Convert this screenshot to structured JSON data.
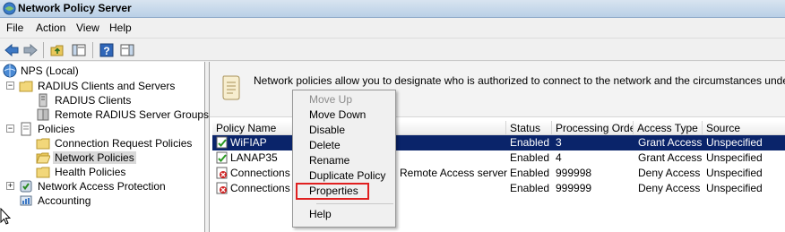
{
  "window": {
    "title": "Network Policy Server"
  },
  "menubar": [
    "File",
    "Action",
    "View",
    "Help"
  ],
  "tree": {
    "root": "NPS (Local)",
    "radius_clients_servers": "RADIUS Clients and Servers",
    "radius_clients": "RADIUS Clients",
    "remote_radius_groups": "Remote RADIUS Server Groups",
    "policies": "Policies",
    "connection_request_policies": "Connection Request Policies",
    "network_policies": "Network Policies",
    "health_policies": "Health Policies",
    "network_access_protection": "Network Access Protection",
    "accounting": "Accounting"
  },
  "banner": {
    "description": "Network policies allow you to designate who is authorized to connect to the network and the circumstances under which they c"
  },
  "grid": {
    "columns": [
      "Policy Name",
      "Status",
      "Processing Order",
      "Access Type",
      "Source"
    ],
    "rows": [
      {
        "name": "WiFIAP",
        "status": "Enabled",
        "order": "3",
        "access": "Grant Access",
        "source": "Unspecified"
      },
      {
        "name": "LANAP35",
        "status": "Enabled",
        "order": "4",
        "access": "Grant Access",
        "source": "Unspecified"
      },
      {
        "name": "Connections to",
        "name_tail": "Remote Access server",
        "status": "Enabled",
        "order": "999998",
        "access": "Deny Access",
        "source": "Unspecified"
      },
      {
        "name": "Connections to",
        "status": "Enabled",
        "order": "999999",
        "access": "Deny Access",
        "source": "Unspecified"
      }
    ]
  },
  "context_menu": {
    "move_up": "Move Up",
    "move_down": "Move Down",
    "disable": "Disable",
    "delete": "Delete",
    "rename": "Rename",
    "duplicate": "Duplicate Policy",
    "properties": "Properties",
    "help": "Help"
  },
  "colors": {
    "selection": "#0a246a",
    "highlight_box": "#e02020"
  }
}
